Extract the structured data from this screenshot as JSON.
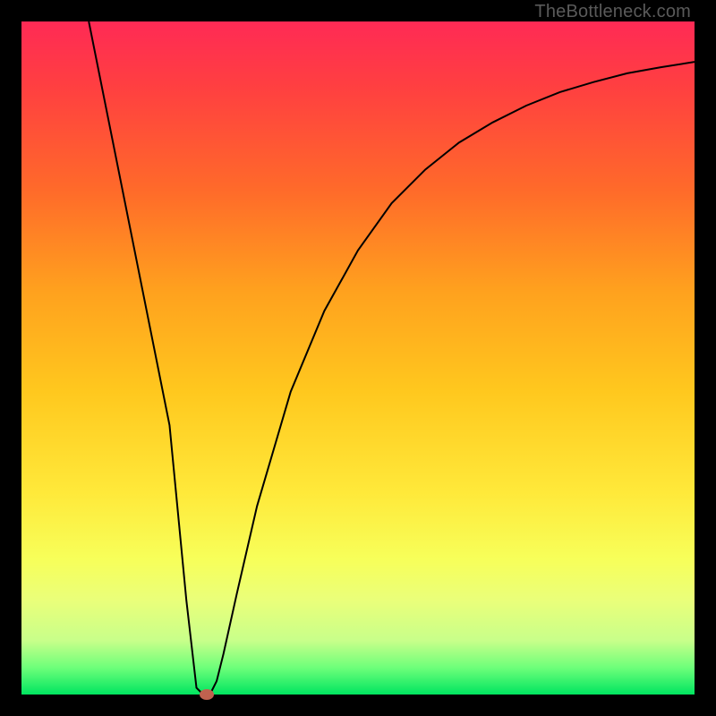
{
  "watermark": "TheBottleneck.com",
  "chart_data": {
    "type": "line",
    "title": "",
    "xlabel": "",
    "ylabel": "",
    "xlim": [
      0,
      100
    ],
    "ylim": [
      0,
      100
    ],
    "grid": false,
    "background_gradient": {
      "top_color": "#ff2a55",
      "bottom_color": "#00e560"
    },
    "series": [
      {
        "name": "bottleneck-curve",
        "color": "#000000",
        "x": [
          10,
          14,
          18,
          22,
          24.5,
          26,
          27,
          28,
          29,
          30,
          32,
          35,
          40,
          45,
          50,
          55,
          60,
          65,
          70,
          75,
          80,
          85,
          90,
          95,
          100
        ],
        "values": [
          100,
          80,
          60,
          40,
          14,
          1,
          0,
          0,
          2,
          6,
          15,
          28,
          45,
          57,
          66,
          73,
          78,
          82,
          85,
          87.5,
          89.5,
          91,
          92.3,
          93.2,
          94
        ]
      }
    ],
    "annotations": [
      {
        "name": "optimal-point-marker",
        "x": 27.5,
        "y": 0,
        "color": "#c0624f"
      }
    ]
  }
}
